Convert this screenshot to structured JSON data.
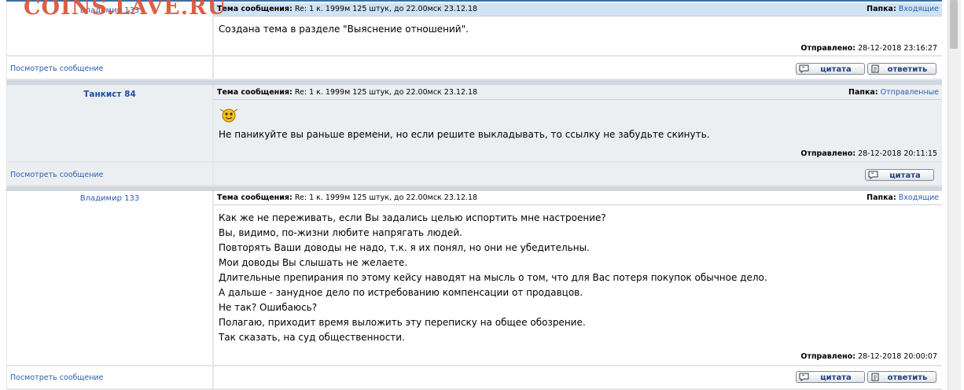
{
  "watermark": "COINS.LAVE.RU",
  "labels": {
    "subject": "Тема сообщения:",
    "folder": "Папка:",
    "sent": "Отправлено:",
    "view_message": "Посмотреть сообщение",
    "quote": "цитата",
    "reply": "ответить"
  },
  "posts": [
    {
      "author": "Владимир 133",
      "subject": "Re: 1 к. 1999м 125 штук, до 22.00мск 23.12.18",
      "folder": "Входящие",
      "lines": [
        "Создана тема в разделе \"Выяснение отношений\"."
      ],
      "sent": "28-12-2018 23:16:27"
    },
    {
      "author": "Танкист 84",
      "subject": "Re: 1 к. 1999м 125 штук, до 22.00мск 23.12.18",
      "folder": "Отправленные",
      "lines": [
        "Не паникуйте вы раньше времени, но если решите выкладывать, то ссылку не забудьте скинуть."
      ],
      "sent": "28-12-2018 20:11:15"
    },
    {
      "author": "Владимир 133",
      "subject": "Re: 1 к. 1999м 125 штук, до 22.00мск 23.12.18",
      "folder": "Входящие",
      "lines": [
        "Как же не переживать, если Вы задались целью испортить мне настроение?",
        "Вы, видимо, по-жизни любите напрягать людей.",
        "Повторять Ваши доводы не надо, т.к. я их понял, но они не убедительны.",
        "Мои доводы Вы слышать не желаете.",
        "Длительные препирания по этому кейсу наводят на мысль о том, что для Вас потеря покупок обычное дело.",
        "А дальше - занудное дело по истребованию компенсации от продавцов.",
        "Не так? Ошибаюсь?",
        "Полагаю, приходит время выложить эту переписку на общее обозрение.",
        "Так сказать, на суд общественности."
      ],
      "sent": "28-12-2018 20:00:07"
    }
  ]
}
